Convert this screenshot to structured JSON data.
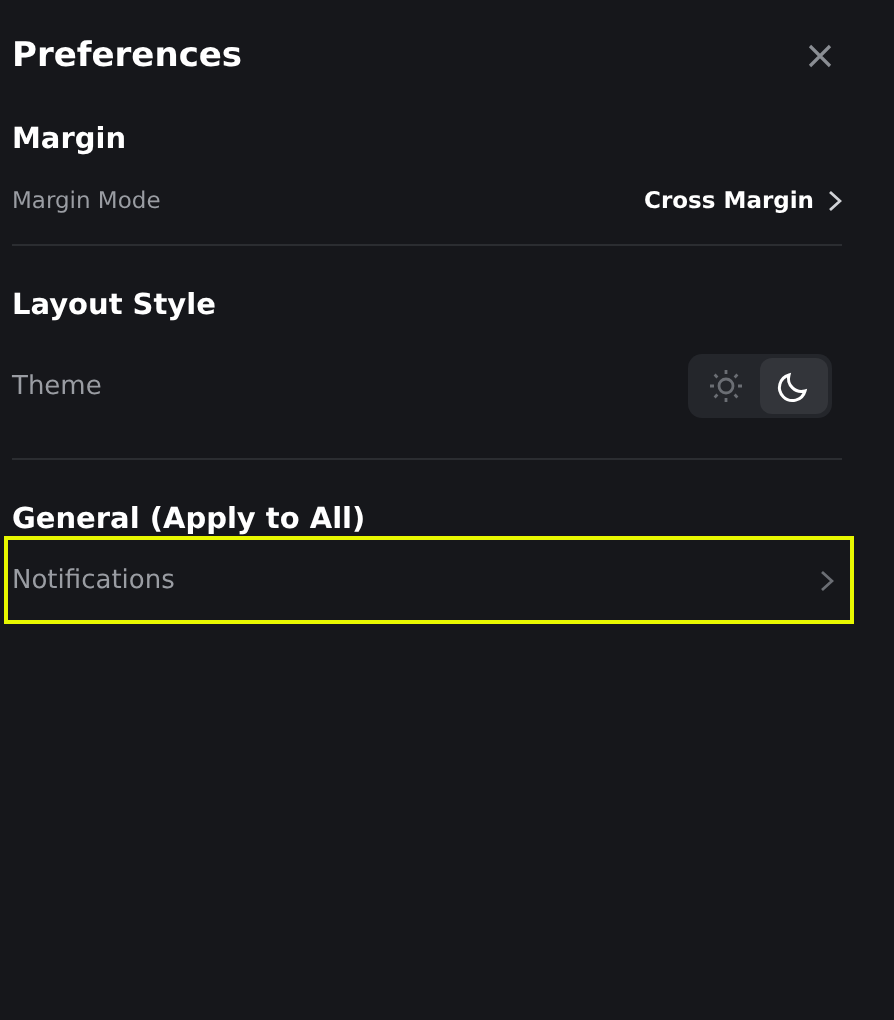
{
  "panel": {
    "title": "Preferences"
  },
  "sections": [
    {
      "heading": "Margin",
      "rows": [
        {
          "kind": "link",
          "label": "Margin Mode",
          "value": "Cross Margin",
          "highlighted": false
        }
      ]
    },
    {
      "heading": "Layout Style",
      "rows": [
        {
          "kind": "theme",
          "label": "Theme",
          "options": [
            {
              "kind": "light",
              "selected": false
            },
            {
              "kind": "dark",
              "selected": true
            }
          ]
        }
      ]
    },
    {
      "heading": "General (Apply to All)",
      "rows": [
        {
          "kind": "link",
          "label": "Notifications",
          "highlighted": true
        }
      ]
    }
  ]
}
